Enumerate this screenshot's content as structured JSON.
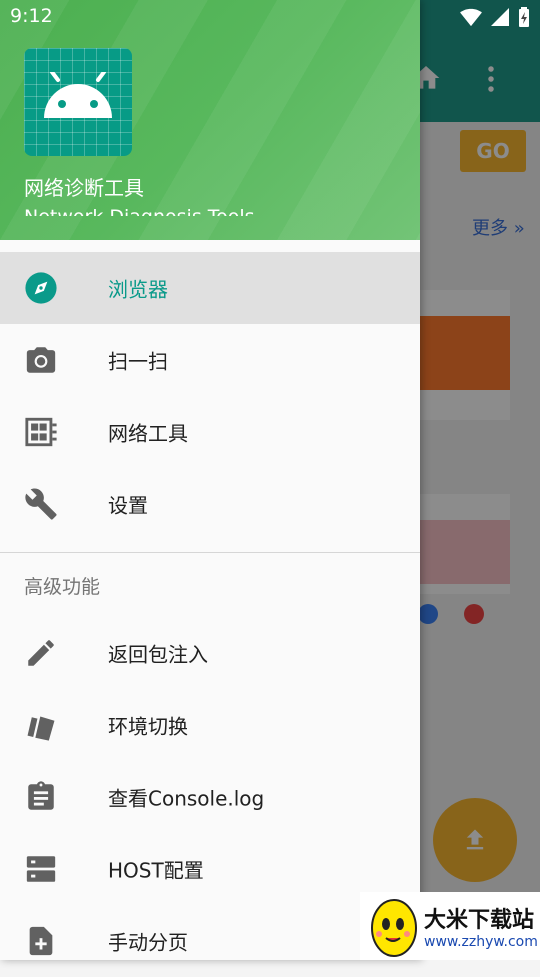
{
  "status_bar": {
    "time": "9:12"
  },
  "background_app": {
    "go_button": "GO",
    "more_link": "更多 »",
    "colors": {
      "app_bar": "#1f9b8b",
      "accent": "#f7b731"
    }
  },
  "drawer": {
    "app_name": "网络诊断工具",
    "app_subtitle": "Network Diagnosis Tools",
    "items": [
      {
        "label": "浏览器",
        "icon": "compass-icon",
        "active": true
      },
      {
        "label": "扫一扫",
        "icon": "camera-icon"
      },
      {
        "label": "网络工具",
        "icon": "network-tools-icon"
      },
      {
        "label": "设置",
        "icon": "wrench-icon"
      }
    ],
    "section_title": "高级功能",
    "advanced_items": [
      {
        "label": "返回包注入",
        "icon": "pencil-icon"
      },
      {
        "label": "环境切换",
        "icon": "cards-icon"
      },
      {
        "label": "查看Console.log",
        "icon": "clipboard-icon"
      },
      {
        "label": "HOST配置",
        "icon": "server-icon"
      },
      {
        "label": "手动分页",
        "icon": "add-page-icon"
      }
    ]
  },
  "watermark": {
    "title": "大米下载站",
    "url": "www.zzhyw.com"
  }
}
